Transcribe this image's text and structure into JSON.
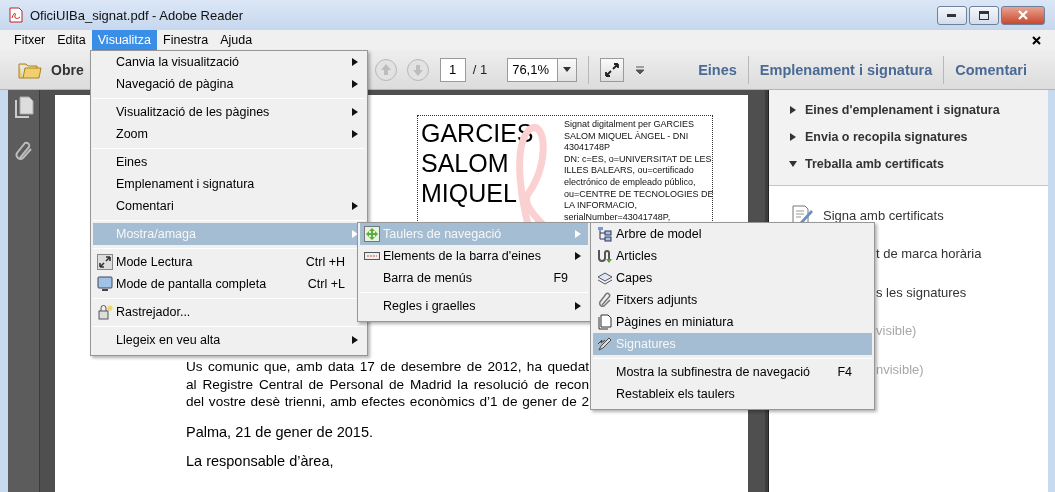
{
  "window": {
    "title": "OficiUIBa_signat.pdf - Adobe Reader"
  },
  "menu_bar": {
    "items": [
      {
        "label": "Fitxer",
        "selected": false
      },
      {
        "label": "Edita",
        "selected": false
      },
      {
        "label": "Visualitza",
        "selected": true
      },
      {
        "label": "Finestra",
        "selected": false
      },
      {
        "label": "Ajuda",
        "selected": false
      }
    ]
  },
  "toolbar": {
    "open_button": "Obre",
    "page_field": "1",
    "page_total": "/ 1",
    "zoom_field": "76,1%",
    "panel_buttons": [
      "Eines",
      "Emplenament i signatura",
      "Comentari"
    ]
  },
  "document": {
    "signature": {
      "name_lines": [
        "GARCIES",
        "SALOM",
        "MIQUEL"
      ],
      "details": [
        "Signat digitalment per GARCIES",
        "SALOM MIQUEL ÀNGEL - DNI",
        "43041748P",
        "DN: c=ES, o=UNIVERSITAT DE LES",
        "ILLES BALEARS, ou=certificado",
        "electrónico de empleado público,",
        "ou=CENTRE DE TECNOLOGIES DE",
        "LA INFORMACIO,",
        "serialNumber=43041748P,"
      ]
    },
    "paragraph_lines": [
      "Us comunic que, amb data 17 de desembre de 2012, ha quedat",
      "al Registre Central de Personal de Madrid la resolució de recon",
      "del vostre desè trienni, amb efectes econòmics d’1 de gener de 2"
    ],
    "place_date": "Palma, 21 de gener de 2015.",
    "closing": "La responsable d’àrea,"
  },
  "tools_panel": {
    "sections": [
      {
        "label": "Eines d'emplenament i signatura",
        "expanded": false
      },
      {
        "label": "Envia o recopila signatures",
        "expanded": false
      },
      {
        "label": "Treballa amb certificats",
        "expanded": true
      }
    ],
    "items": [
      {
        "kind": "full",
        "label": "Signa amb certificats",
        "disabled": false
      },
      {
        "kind": "partial",
        "label": "t de marca horària",
        "disabled": false
      },
      {
        "kind": "partial",
        "label": "s les signatures",
        "disabled": false
      },
      {
        "kind": "partial",
        "label": "visible)",
        "disabled": true
      },
      {
        "kind": "partial",
        "label": "nvisible)",
        "disabled": true
      }
    ]
  },
  "view_menu": {
    "items": [
      {
        "kind": "item",
        "label": "Canvia la visualització",
        "submenu": true,
        "selected": false
      },
      {
        "kind": "item",
        "label": "Navegació de pàgina",
        "submenu": true,
        "selected": false
      },
      {
        "kind": "separator"
      },
      {
        "kind": "item",
        "label": "Visualització de les pàgines",
        "submenu": true,
        "selected": false
      },
      {
        "kind": "item",
        "label": "Zoom",
        "submenu": true,
        "selected": false
      },
      {
        "kind": "separator"
      },
      {
        "kind": "item",
        "label": "Eines",
        "submenu": false,
        "selected": false
      },
      {
        "kind": "item",
        "label": "Emplenament i signatura",
        "submenu": false,
        "selected": false
      },
      {
        "kind": "item",
        "label": "Comentari",
        "submenu": true,
        "selected": false
      },
      {
        "kind": "separator"
      },
      {
        "kind": "item",
        "label": "Mostra/amaga",
        "submenu": true,
        "selected": true
      },
      {
        "kind": "separator"
      },
      {
        "kind": "item",
        "label": "Mode Lectura",
        "shortcut": "Ctrl +H",
        "submenu": false,
        "selected": false
      },
      {
        "kind": "item",
        "label": "Mode de pantalla completa",
        "shortcut": "Ctrl +L",
        "submenu": false,
        "selected": false
      },
      {
        "kind": "separator"
      },
      {
        "kind": "item",
        "label": "Rastrejador...",
        "submenu": false,
        "selected": false
      },
      {
        "kind": "separator"
      },
      {
        "kind": "item",
        "label": "Llegeix en veu alta",
        "submenu": true,
        "selected": false
      }
    ]
  },
  "show_hide_menu": {
    "items": [
      {
        "kind": "item",
        "label": "Taulers de navegació",
        "submenu": true,
        "selected": true
      },
      {
        "kind": "item",
        "label": "Elements de la barra d'eines",
        "submenu": true,
        "selected": false
      },
      {
        "kind": "item",
        "label": "Barra de menús",
        "shortcut": "F9",
        "submenu": false,
        "selected": false
      },
      {
        "kind": "separator"
      },
      {
        "kind": "item",
        "label": "Regles i graelles",
        "submenu": true,
        "selected": false
      }
    ]
  },
  "panels_menu": {
    "items": [
      {
        "kind": "item",
        "label": "Arbre de model",
        "submenu": false,
        "selected": false
      },
      {
        "kind": "item",
        "label": "Articles",
        "submenu": false,
        "selected": false
      },
      {
        "kind": "item",
        "label": "Capes",
        "submenu": false,
        "selected": false
      },
      {
        "kind": "item",
        "label": "Fitxers adjunts",
        "submenu": false,
        "selected": false
      },
      {
        "kind": "item",
        "label": "Pàgines en miniatura",
        "submenu": false,
        "selected": false
      },
      {
        "kind": "item",
        "label": "Signatures",
        "submenu": false,
        "selected": true
      },
      {
        "kind": "separator"
      },
      {
        "kind": "item",
        "label": "Mostra la subfinestra de navegació",
        "shortcut": "F4",
        "submenu": false,
        "selected": false
      },
      {
        "kind": "item",
        "label": "Restableix els taulers",
        "submenu": false,
        "selected": false
      }
    ]
  }
}
